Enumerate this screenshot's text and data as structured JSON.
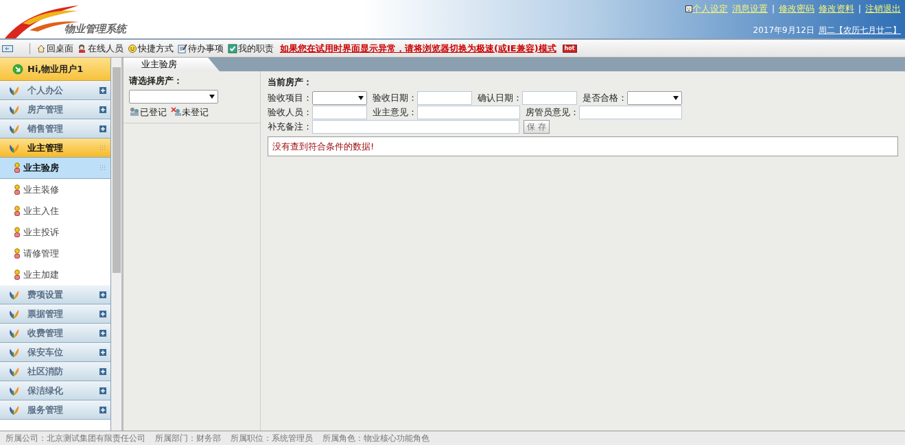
{
  "header": {
    "title": "物业管理系统",
    "links": [
      {
        "label": "个人设定",
        "kind": "icon-link"
      },
      {
        "label": "消息设置",
        "kind": "link"
      },
      {
        "label": "|",
        "kind": "divider"
      },
      {
        "label": "修改密码",
        "kind": "link"
      },
      {
        "label": "修改资料",
        "kind": "link"
      },
      {
        "label": "|",
        "kind": "divider"
      },
      {
        "label": "注销退出",
        "kind": "link"
      }
    ],
    "date": "2017年9月12日",
    "lunar": "周二【农历七月廿二】"
  },
  "toolbar": {
    "items": [
      {
        "label": "回桌面",
        "kind": "house"
      },
      {
        "label": "在线人员",
        "kind": "people"
      },
      {
        "label": "快捷方式",
        "kind": "smiley"
      },
      {
        "label": "待办事项",
        "kind": "note"
      },
      {
        "label": "我的职责",
        "kind": "check"
      }
    ],
    "notice": "如果您在试用时界面显示异常，请将浏览器切换为极速(或IE兼容)模式",
    "badge": "hot"
  },
  "sidebar": {
    "greeting": "Hi,物业用户1",
    "items": [
      {
        "label": "个人办公",
        "expanded": false,
        "selected": false
      },
      {
        "label": "房产管理",
        "expanded": false,
        "selected": false
      },
      {
        "label": "销售管理",
        "expanded": false,
        "selected": false
      },
      {
        "label": "业主管理",
        "expanded": true,
        "selected": true,
        "children": [
          {
            "label": "业主验房",
            "selected": true
          },
          {
            "label": "业主装修",
            "selected": false
          },
          {
            "label": "业主入住",
            "selected": false
          },
          {
            "label": "业主投诉",
            "selected": false
          },
          {
            "label": "请修管理",
            "selected": false
          },
          {
            "label": "业主加建",
            "selected": false
          }
        ]
      },
      {
        "label": "费项设置",
        "expanded": false,
        "selected": false
      },
      {
        "label": "票据管理",
        "expanded": false,
        "selected": false
      },
      {
        "label": "收费管理",
        "expanded": false,
        "selected": false
      },
      {
        "label": "保安车位",
        "expanded": false,
        "selected": false
      },
      {
        "label": "社区消防",
        "expanded": false,
        "selected": false
      },
      {
        "label": "保洁绿化",
        "expanded": false,
        "selected": false
      },
      {
        "label": "服务管理",
        "expanded": false,
        "selected": false
      }
    ]
  },
  "tabs": [
    {
      "label": "业主验房",
      "selected": true
    }
  ],
  "left_panel": {
    "label": "请选择房产：",
    "legend": [
      {
        "label": "已登记",
        "kind": "registered"
      },
      {
        "label": "未登记",
        "kind": "unregistered"
      }
    ]
  },
  "form": {
    "title": "当前房产：",
    "rows": [
      [
        {
          "label": "验收项目：",
          "kind": "select"
        },
        {
          "label": "验收日期：",
          "kind": "text"
        },
        {
          "label": "确认日期：",
          "kind": "text"
        },
        {
          "label": "是否合格：",
          "kind": "select"
        }
      ],
      [
        {
          "label": "验收人员：",
          "kind": "text"
        },
        {
          "label": "业主意见：",
          "kind": "wide"
        },
        {
          "label": "房管员意见：",
          "kind": "wide"
        }
      ],
      [
        {
          "label": "补充备注：",
          "kind": "extra"
        }
      ]
    ],
    "save_button": "保 存",
    "message": "没有查到符合条件的数据!"
  },
  "status_bar": [
    "所属公司：北京测试集团有限责任公司",
    "所属部门：财务部",
    "所属职位：系统管理员",
    "所属角色：物业核心功能角色"
  ]
}
